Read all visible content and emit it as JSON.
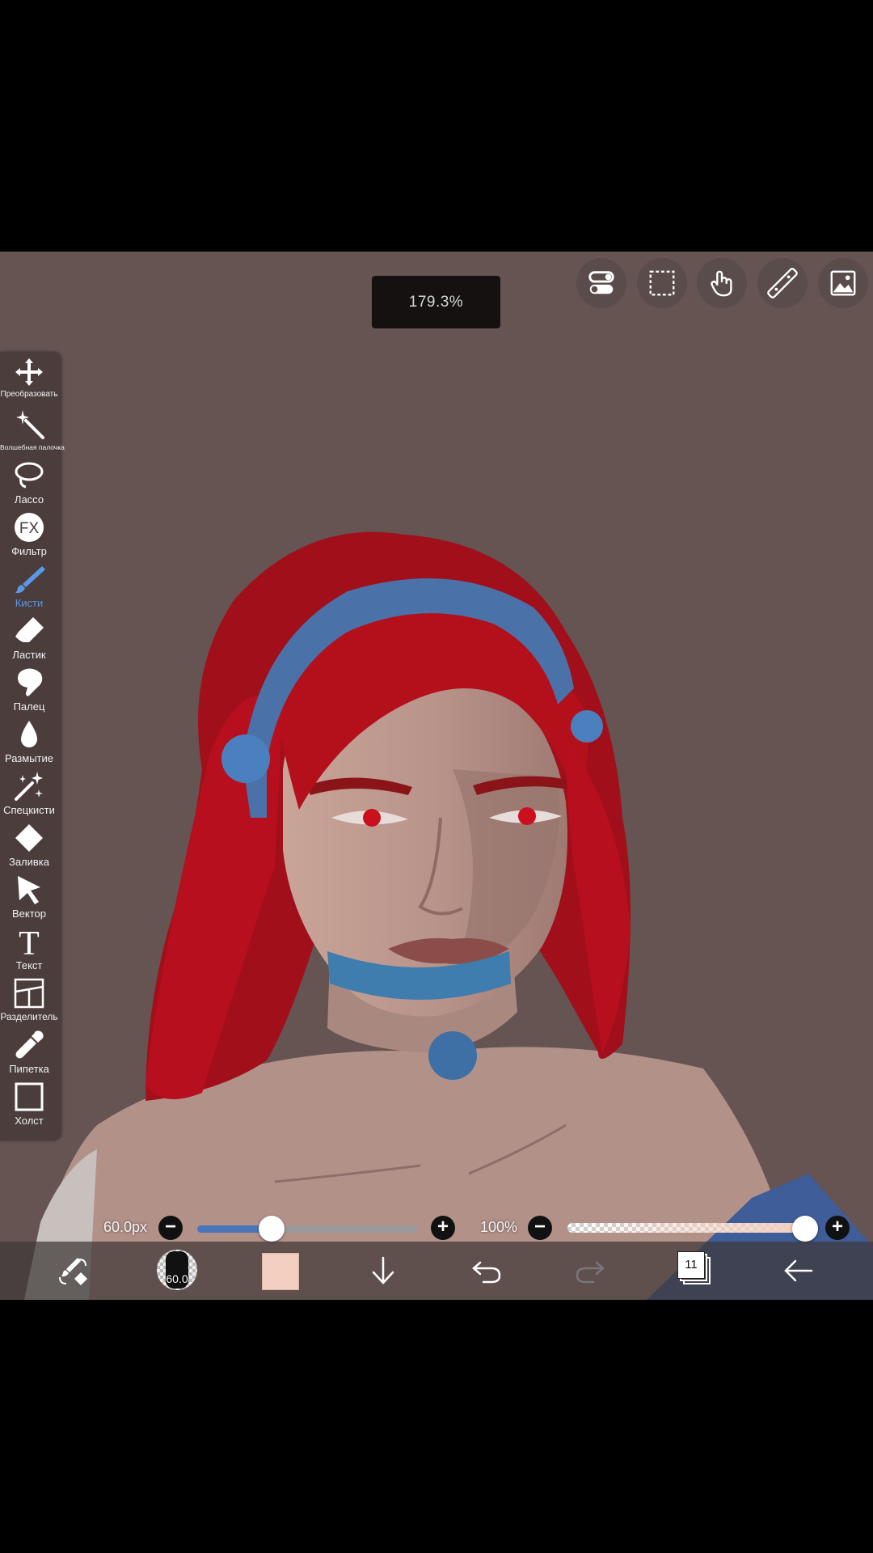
{
  "zoom_label": "179.3%",
  "top_tools": [
    {
      "name": "quick-settings-icon"
    },
    {
      "name": "selection-icon"
    },
    {
      "name": "touch-hand-icon"
    },
    {
      "name": "ruler-icon"
    },
    {
      "name": "material-image-icon"
    }
  ],
  "tools": [
    {
      "label": "Преобразовать",
      "icon": "move-icon"
    },
    {
      "label": "Волшебная палочка",
      "icon": "magic-wand-icon"
    },
    {
      "label": "Лассо",
      "icon": "lasso-icon"
    },
    {
      "label": "Фильтр",
      "icon": "filter-fx-icon"
    },
    {
      "label": "Кисти",
      "icon": "brush-icon",
      "active": true
    },
    {
      "label": "Ластик",
      "icon": "eraser-icon"
    },
    {
      "label": "Палец",
      "icon": "finger-smudge-icon"
    },
    {
      "label": "Размытие",
      "icon": "blur-drop-icon"
    },
    {
      "label": "Спецкисти",
      "icon": "special-brush-icon"
    },
    {
      "label": "Заливка",
      "icon": "fill-bucket-icon"
    },
    {
      "label": "Вектор",
      "icon": "vector-cursor-icon"
    },
    {
      "label": "Текст",
      "icon": "text-icon"
    },
    {
      "label": "Разделитель",
      "icon": "frame-divider-icon"
    },
    {
      "label": "Пипетка",
      "icon": "eyedropper-icon"
    },
    {
      "label": "Холст",
      "icon": "canvas-icon"
    }
  ],
  "brush_size": {
    "label": "60.0px",
    "fraction": 0.34
  },
  "opacity": {
    "label": "100%",
    "fraction": 1.0
  },
  "brush_preview_label": "60.0",
  "current_color": "#f2cfc0",
  "layers_count": "11",
  "colors": {
    "canvas_bg": "#655452",
    "accent": "#5b97e8"
  }
}
